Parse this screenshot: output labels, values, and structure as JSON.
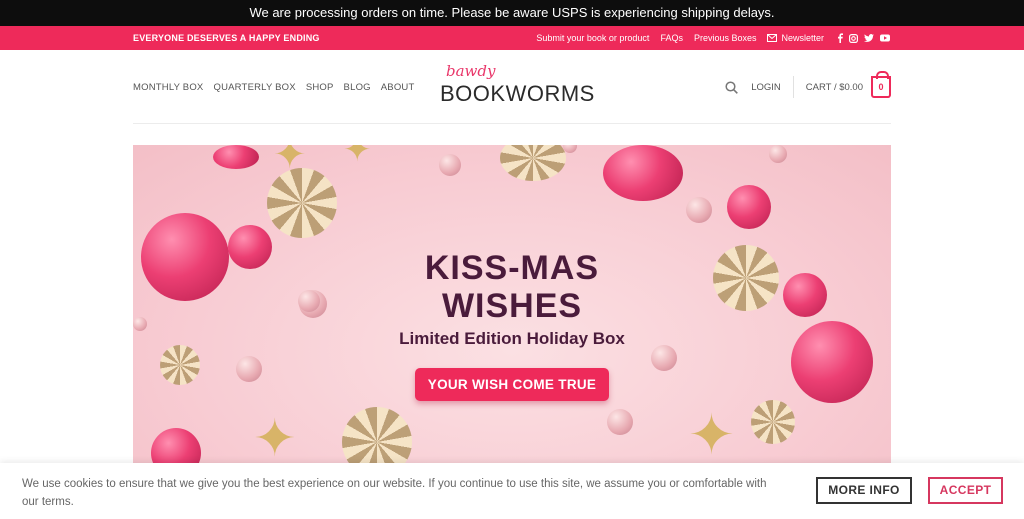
{
  "notice": {
    "text": "We are processing orders on time. Please be aware USPS is experiencing shipping delays."
  },
  "topbar": {
    "tagline": "EVERYONE DESERVES A HAPPY ENDING",
    "links": [
      "Submit your book or product",
      "FAQs",
      "Previous Boxes",
      "Newsletter"
    ],
    "social_icons": [
      "facebook-icon",
      "instagram-icon",
      "twitter-icon",
      "youtube-icon"
    ]
  },
  "nav": {
    "items": [
      "MONTHLY BOX",
      "QUARTERLY BOX",
      "SHOP",
      "BLOG",
      "ABOUT"
    ]
  },
  "logo": {
    "script": "bawdy",
    "main": "BOOKWORMS"
  },
  "account": {
    "login": "LOGIN",
    "cart": "CART / $0.00",
    "cart_count": "0"
  },
  "hero": {
    "title_line1": "KISS-MAS",
    "title_line2": "WISHES",
    "subtitle": "Limited Edition Holiday Box",
    "button": "YOUR WISH COME TRUE"
  },
  "cookie": {
    "message": "We use cookies to ensure that we give you the best experience on our website. If you continue to use this site, we assume you or comfortable with our terms.",
    "more_info": "MORE INFO",
    "accept": "ACCEPT"
  },
  "colors": {
    "accent": "#ee2a5a",
    "dark_text": "#4a1b3b",
    "notice_bg": "#0d0d0d"
  }
}
